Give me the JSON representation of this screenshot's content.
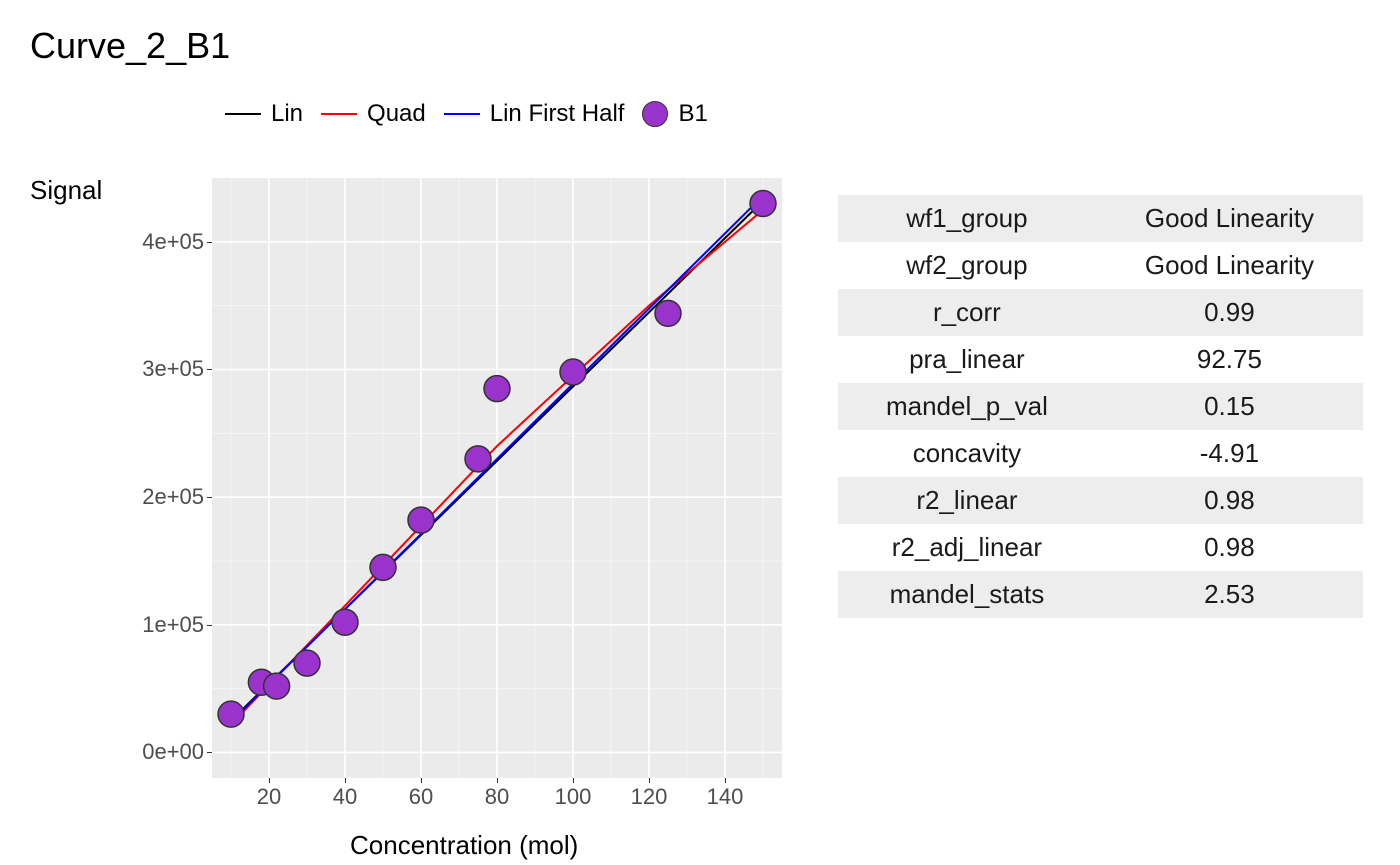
{
  "title": "Curve_2_B1",
  "ylabel": "Signal",
  "xlabel": "Concentration (mol)",
  "legend": {
    "lin": "Lin",
    "quad": "Quad",
    "linfh": "Lin First Half",
    "b1": "B1"
  },
  "colors": {
    "lin": "#000000",
    "quad": "#ff0000",
    "linfh": "#0000ff",
    "point_fill": "#9933cc",
    "point_stroke": "#333333",
    "panel": "#ebebeb",
    "grid_major": "#ffffff",
    "grid_minor": "#f5f5f5"
  },
  "chart_data": {
    "type": "scatter",
    "title": "Curve_2_B1",
    "xlabel": "Concentration (mol)",
    "ylabel": "Signal",
    "xlim": [
      5,
      155
    ],
    "ylim": [
      -20000,
      450000
    ],
    "x_ticks": [
      20,
      40,
      60,
      80,
      100,
      120,
      140
    ],
    "y_ticks": [
      0,
      100000,
      200000,
      300000,
      400000
    ],
    "y_tick_labels": [
      "0e+00",
      "1e+05",
      "2e+05",
      "3e+05",
      "4e+05"
    ],
    "series": [
      {
        "name": "B1",
        "type": "scatter",
        "x": [
          10,
          18,
          22,
          30,
          40,
          50,
          60,
          75,
          80,
          100,
          125,
          150
        ],
        "y": [
          30000,
          55000,
          52000,
          70000,
          102000,
          145000,
          182000,
          230000,
          285000,
          298000,
          344000,
          430000
        ]
      },
      {
        "name": "Lin",
        "type": "line",
        "x": [
          10,
          150
        ],
        "y": [
          25000,
          432000
        ]
      },
      {
        "name": "Quad",
        "type": "line",
        "x": [
          10,
          40,
          80,
          120,
          150
        ],
        "y": [
          22000,
          115000,
          240000,
          350000,
          425000
        ]
      },
      {
        "name": "Lin First Half",
        "type": "line",
        "x": [
          10,
          150
        ],
        "y": [
          24000,
          436000
        ]
      }
    ]
  },
  "stats": [
    {
      "label": "wf1_group",
      "value": "Good Linearity"
    },
    {
      "label": "wf2_group",
      "value": "Good Linearity"
    },
    {
      "label": "r_corr",
      "value": "0.99"
    },
    {
      "label": "pra_linear",
      "value": "92.75"
    },
    {
      "label": "mandel_p_val",
      "value": "0.15"
    },
    {
      "label": "concavity",
      "value": "-4.91"
    },
    {
      "label": "r2_linear",
      "value": "0.98"
    },
    {
      "label": "r2_adj_linear",
      "value": "0.98"
    },
    {
      "label": "mandel_stats",
      "value": "2.53"
    }
  ]
}
